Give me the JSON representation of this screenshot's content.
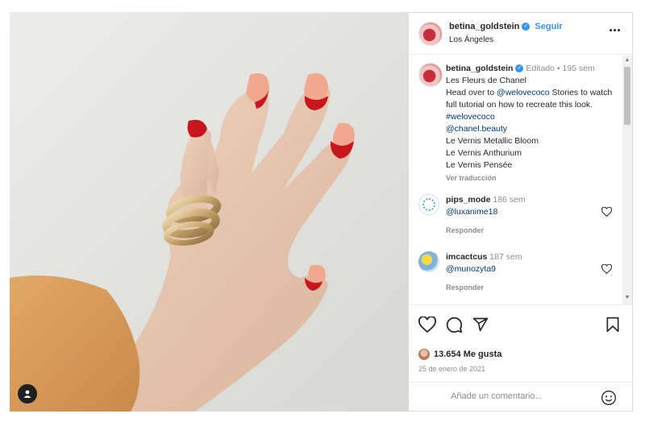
{
  "post": {
    "author": "betina_goldstein",
    "follow_label": "Seguir",
    "location": "Los Ángeles"
  },
  "caption": {
    "author": "betina_goldstein",
    "edited": "Editado",
    "separator": "•",
    "age": "195 sem",
    "lines": [
      "Les Fleurs de Chanel",
      "Head over to",
      "@welovecoco",
      "Stories to watch full tutorial on how to recreate this look.",
      "#welovecoco",
      "@chanel.beauty",
      "Le Vernis Metallic Bloom",
      "Le Vernis Anthurium",
      "Le Vernis Pensée"
    ],
    "translate": "Ver traducción"
  },
  "comments": [
    {
      "user": "pips_mode",
      "age": "186 sem",
      "text": "@luxanime18",
      "reply": "Responder"
    },
    {
      "user": "imcactcus",
      "age": "187 sem",
      "text": "@munozyta9",
      "reply": "Responder"
    }
  ],
  "stats": {
    "likes": "13.654 Me gusta",
    "date": "25 de enero de 2021"
  },
  "comment_input": {
    "placeholder": "Añade un comentario..."
  },
  "icons": [
    "more-icon",
    "verified-icon",
    "heart-icon",
    "comment-icon",
    "share-icon",
    "bookmark-icon",
    "emoji-icon",
    "user-tag-icon"
  ],
  "colors": {
    "accent": "#3797f0",
    "nail_red": "#c8161e",
    "nail_pink": "#f1a88e",
    "sleeve": "#d99a58",
    "ring_gold": "#c9a872"
  }
}
